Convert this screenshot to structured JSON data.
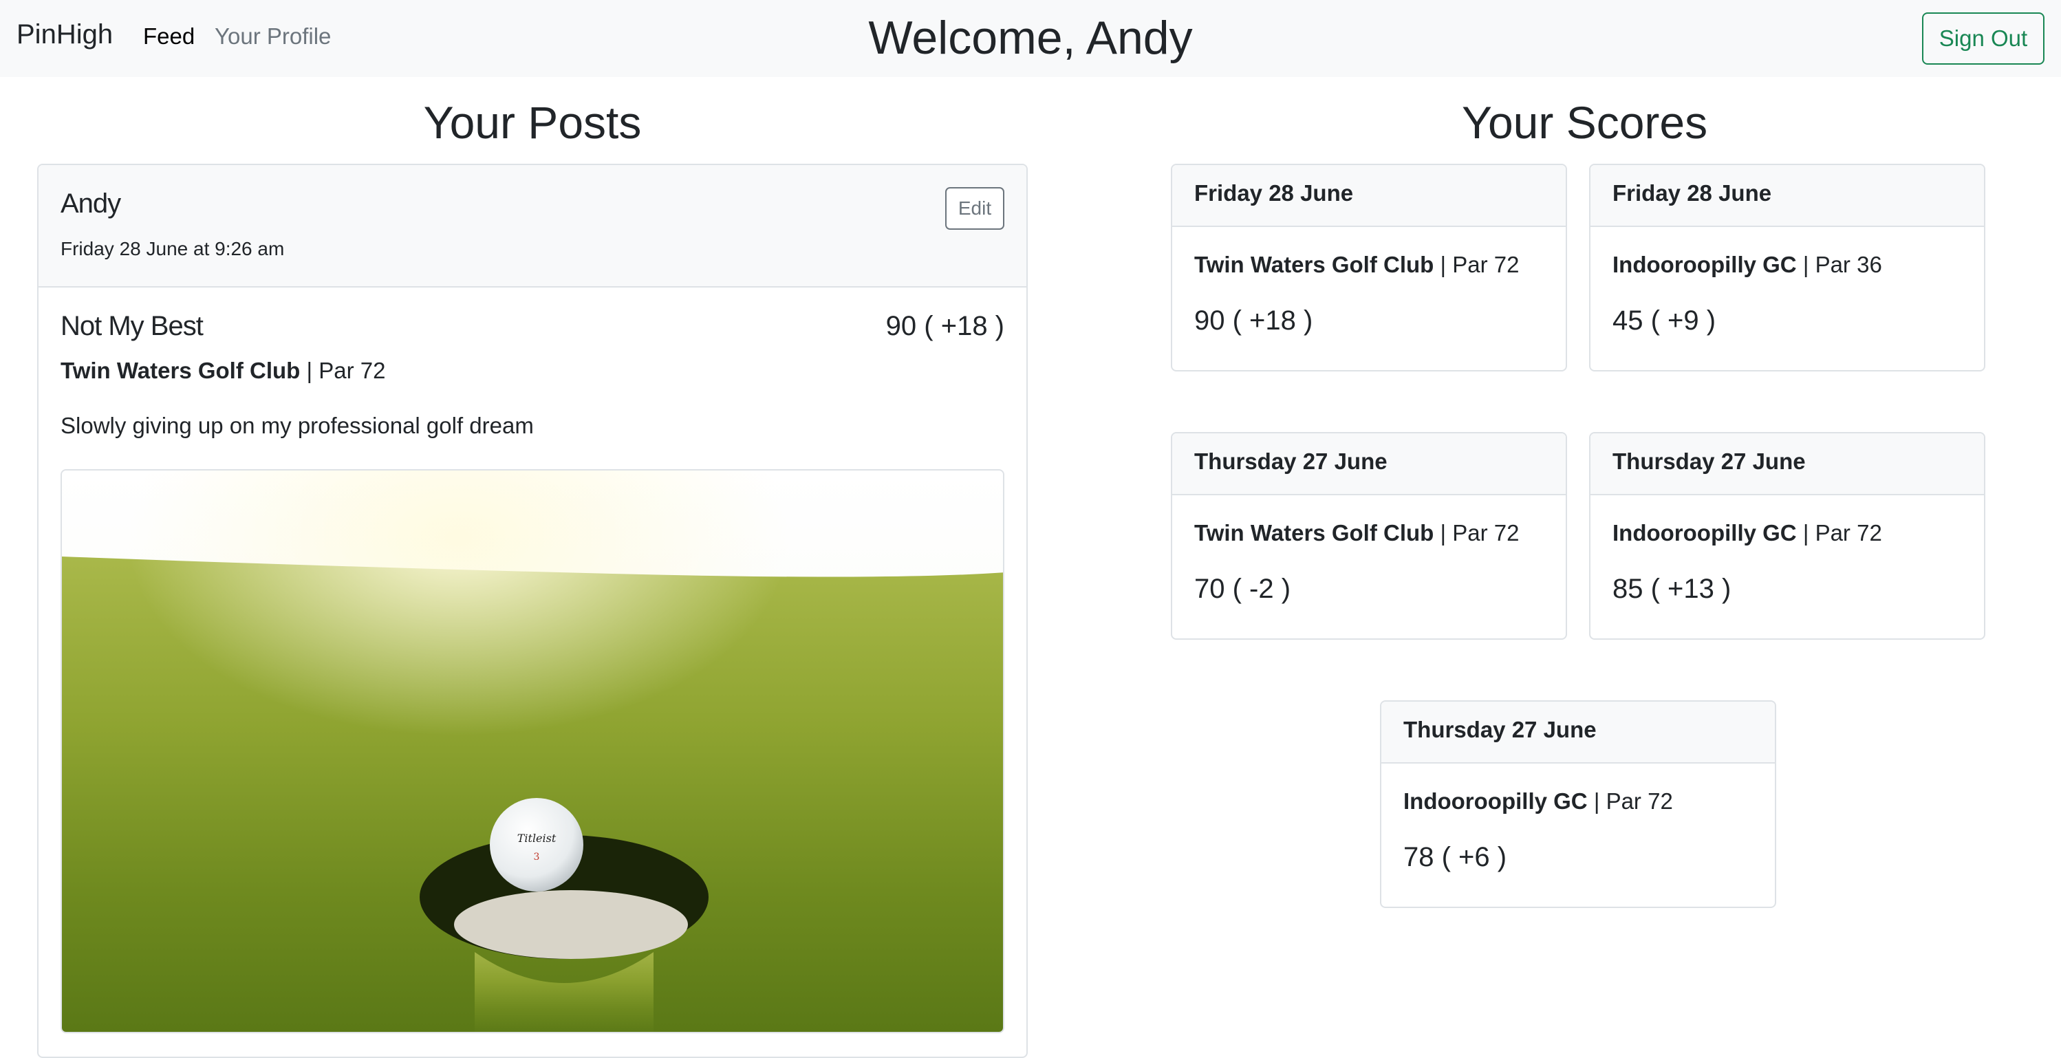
{
  "navbar": {
    "brand": "PinHigh",
    "links": [
      "Feed",
      "Your Profile"
    ],
    "welcome": "Welcome, Andy",
    "sign_out": "Sign Out"
  },
  "posts_section": {
    "title": "Your Posts",
    "post": {
      "author": "Andy",
      "date": "Friday 28 June at 9:26 am",
      "edit_label": "Edit",
      "title": "Not My Best",
      "score": "90 ( +18 )",
      "course": "Twin Waters Golf Club",
      "par": " | Par 72",
      "body": "Slowly giving up on my professional golf dream"
    }
  },
  "scores_section": {
    "title": "Your Scores",
    "cards": [
      {
        "date": "Friday 28 June",
        "course": "Twin Waters Golf Club",
        "par": " | Par 72",
        "score": "90 ( +18 )"
      },
      {
        "date": "Friday 28 June",
        "course": "Indooroopilly GC",
        "par": " | Par 36",
        "score": "45 ( +9 )"
      },
      {
        "date": "Thursday 27 June",
        "course": "Twin Waters Golf Club",
        "par": " | Par 72",
        "score": "70 ( -2 )"
      },
      {
        "date": "Thursday 27 June",
        "course": "Indooroopilly GC",
        "par": " | Par 72",
        "score": "85 ( +13 )"
      },
      {
        "date": "Thursday 27 June",
        "course": "Indooroopilly GC",
        "par": " | Par 72",
        "score": "78 ( +6 )"
      }
    ]
  },
  "colors": {
    "navbar_bg": "#f8f9fa",
    "sign_out": "#198754",
    "card_border": "#dee2e6"
  }
}
